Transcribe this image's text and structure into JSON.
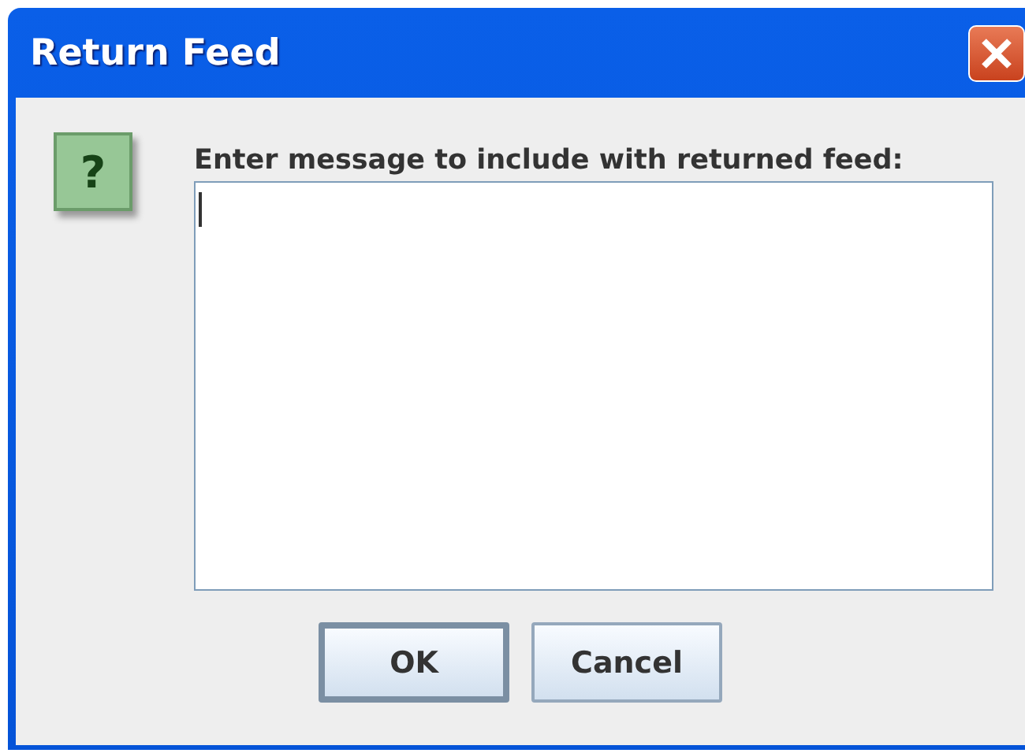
{
  "window": {
    "title": "Return Feed"
  },
  "icon": {
    "glyph": "?"
  },
  "prompt": "Enter message to include with returned feed:",
  "message_field": {
    "focused": true
  },
  "buttons": [
    {
      "label": "OK",
      "default": true
    },
    {
      "label": "Cancel",
      "default": false
    }
  ]
}
